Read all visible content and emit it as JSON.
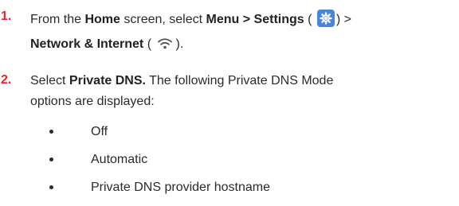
{
  "steps": [
    {
      "number": "1.",
      "line1": {
        "t1": "From the ",
        "b1": "Home",
        "t2": " screen, select ",
        "b2": "Menu > Settings",
        "t3": " (",
        "t4": ") >"
      },
      "line2": {
        "b1": "Network & Internet",
        "t1": " (",
        "t2": ")."
      },
      "settings_icon": "gear-icon",
      "network_icon": "wifi-icon"
    },
    {
      "number": "2.",
      "line1": {
        "t1": "Select ",
        "b1": "Private DNS.",
        "t2": " The following Private DNS Mode"
      },
      "line2": "options are displayed:"
    }
  ],
  "options": [
    "Off",
    "Automatic",
    "Private DNS provider hostname"
  ],
  "colors": {
    "step_number": "#e8262a",
    "settings_icon_bg": "#4a86d8"
  }
}
